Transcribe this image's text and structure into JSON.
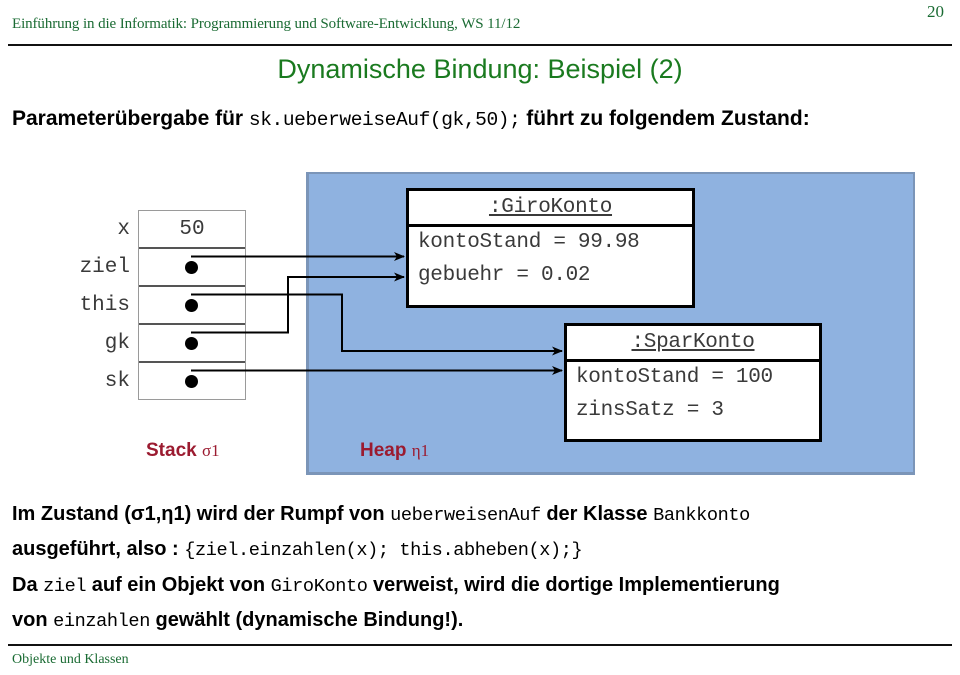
{
  "header": {
    "course_line": "Einführung in die Informatik: Programmierung und Software-Entwicklung, WS 11/12",
    "page_number": "20"
  },
  "title": "Dynamische Bindung: Beispiel (2)",
  "intro": {
    "prefix": "Parameterübergabe für ",
    "code": "sk.ueberweiseAuf(gk,50);",
    "suffix": " führt zu folgendem Zustand:"
  },
  "diagram": {
    "stack_label": "Stack ",
    "stack_label_greek": "σ1",
    "heap_label": "Heap ",
    "heap_label_greek": "η1",
    "stack": {
      "rows": [
        {
          "name": "x",
          "value": "50",
          "kind": "value"
        },
        {
          "name": "ziel",
          "value": "",
          "kind": "reference"
        },
        {
          "name": "this",
          "value": "",
          "kind": "reference"
        },
        {
          "name": "gk",
          "value": "",
          "kind": "reference"
        },
        {
          "name": "sk",
          "value": "",
          "kind": "reference"
        }
      ]
    },
    "objects": [
      {
        "title": ":GiroKonto",
        "attributes": [
          "kontoStand = 99.98",
          "gebuehr = 0.02"
        ]
      },
      {
        "title": ":SparKonto",
        "attributes": [
          "kontoStand = 100",
          "zinsSatz = 3"
        ]
      }
    ],
    "references": [
      {
        "from": "ziel",
        "to": ":GiroKonto"
      },
      {
        "from": "this",
        "to": ":SparKonto"
      },
      {
        "from": "gk",
        "to": ":GiroKonto"
      },
      {
        "from": "sk",
        "to": ":SparKonto"
      }
    ],
    "colors": {
      "heap_background": "#8fb2e0",
      "label_text": "#9b1b30",
      "object_border": "#000000"
    }
  },
  "body": {
    "p1_a": "Im Zustand (σ1,η1) wird der Rumpf von ",
    "p1_code1": "ueberweisenAuf",
    "p1_b": " der Klasse ",
    "p1_code2": "Bankkonto",
    "p2_a": "ausgeführt, also : ",
    "p2_code": "{ziel.einzahlen(x); this.abheben(x);}",
    "p3_a": "Da ",
    "p3_code1": "ziel",
    "p3_b": " auf ein Objekt von ",
    "p3_code2": "GiroKonto",
    "p3_c": " verweist, wird die dortige Implementierung",
    "p4_a": "von ",
    "p4_code": "einzahlen",
    "p4_b": " gewählt (dynamische Bindung!)."
  },
  "footer": {
    "section": "Objekte und Klassen"
  }
}
